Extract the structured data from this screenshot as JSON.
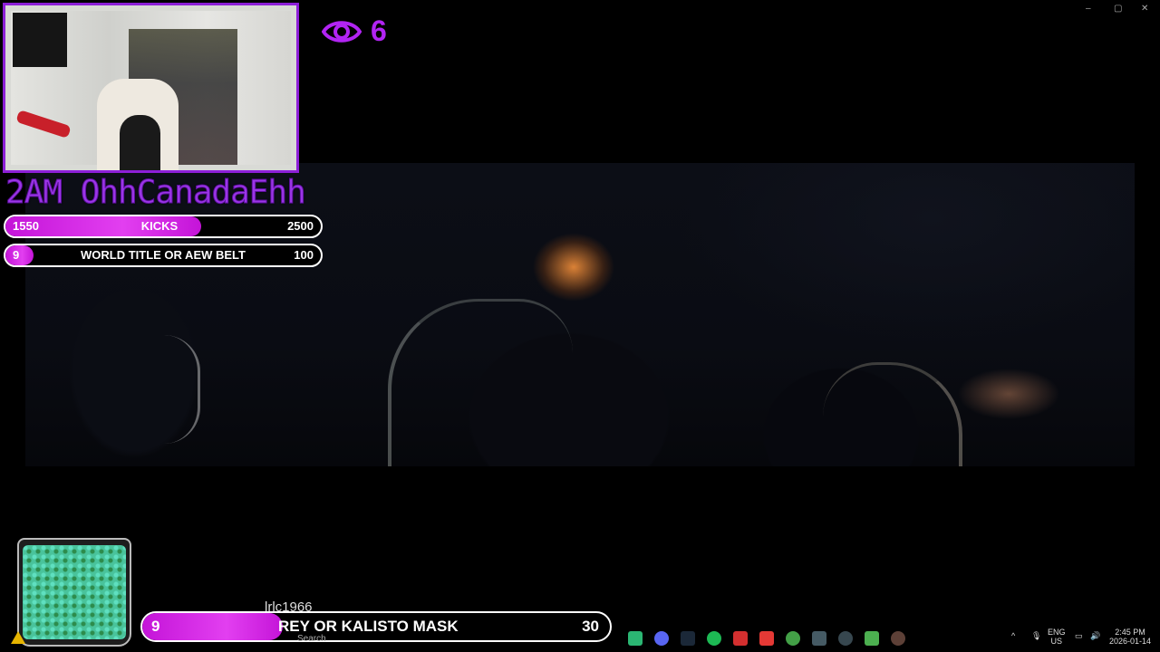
{
  "viewer_count": "6",
  "channel_name": "2AM OhhCanadaEhh",
  "goals": {
    "kicks": {
      "current": "1550",
      "label": "KICKS",
      "target": "2500",
      "progress": 0.62
    },
    "belt": {
      "current": "9",
      "label": "WORLD TITLE OR AEW BELT",
      "target": "100",
      "progress": 0.09
    }
  },
  "bottom_goal": {
    "current": "9",
    "label": "REY OR KALISTO MASK",
    "target": "30",
    "progress": 0.3
  },
  "user_tag": "lrlc1966",
  "taskbar": {
    "search_label": "Search",
    "lang": "ENG",
    "region": "US",
    "time": "2:45 PM",
    "date": "2026-01-14"
  },
  "window_controls": {
    "minimize": "–",
    "maximize": "▢",
    "close": "✕"
  },
  "colors": {
    "accent": "#b224f3",
    "bar_fill": "#d52ee6"
  }
}
